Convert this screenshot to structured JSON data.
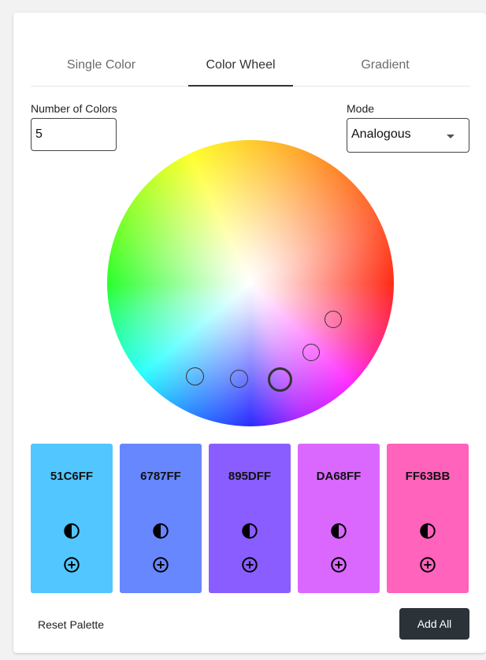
{
  "tabs": [
    {
      "label": "Single Color"
    },
    {
      "label": "Color Wheel"
    },
    {
      "label": "Gradient"
    }
  ],
  "active_tab": "Color Wheel",
  "number_of_colors": {
    "label": "Number of Colors",
    "value": "5"
  },
  "mode": {
    "label": "Mode",
    "value": "Analogous"
  },
  "swatches": [
    {
      "hex": "51C6FF",
      "color": "#51C6FF"
    },
    {
      "hex": "6787FF",
      "color": "#6787FF"
    },
    {
      "hex": "895DFF",
      "color": "#895DFF"
    },
    {
      "hex": "DA68FF",
      "color": "#DA68FF"
    },
    {
      "hex": "FF63BB",
      "color": "#FF63BB"
    }
  ],
  "icons": {
    "contrast": "contrast-icon",
    "add": "add-circle-icon",
    "caret": "caret-down-icon"
  },
  "actions": {
    "reset_label": "Reset Palette",
    "add_all_label": "Add All"
  },
  "colors": {
    "primary_button": "#2b3238",
    "tab_indicator": "#333333"
  }
}
